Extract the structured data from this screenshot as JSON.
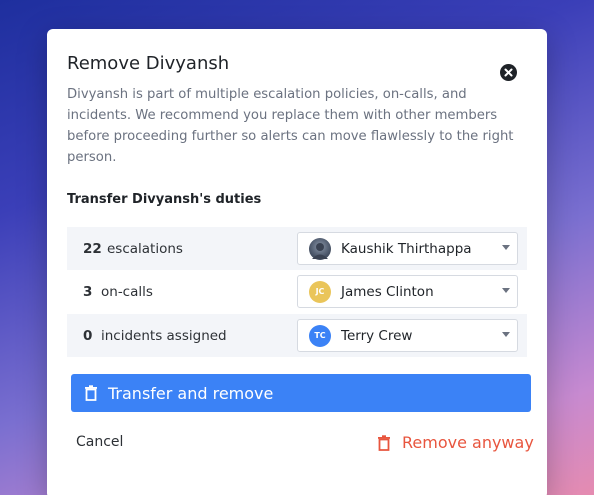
{
  "dialog": {
    "title": "Remove Divyansh",
    "description": "Divyansh is part of multiple escalation policies, on-calls, and incidents. We recommend you replace them with other members before proceeding further so alerts can move flawlessly to the right person.",
    "section_title": "Transfer Divyansh's duties"
  },
  "duties": [
    {
      "count": "22",
      "label": "escalations",
      "assignee": "Kaushik Thirthappa",
      "avatar": "photo"
    },
    {
      "count": "3",
      "label": "on-calls",
      "assignee": "James Clinton",
      "initials": "JC",
      "avatar_color": "#eac55a"
    },
    {
      "count": "0",
      "label": "incidents assigned",
      "assignee": "Terry Crew",
      "initials": "TC",
      "avatar_color": "#3b82f6"
    }
  ],
  "actions": {
    "primary": "Transfer and remove",
    "cancel": "Cancel",
    "danger": "Remove anyway"
  },
  "colors": {
    "accent": "#3b82f6",
    "danger": "#e8553e"
  },
  "icons": {
    "close": "close-circle-icon",
    "trash": "trash-icon",
    "dropdown": "caret-down-icon"
  }
}
